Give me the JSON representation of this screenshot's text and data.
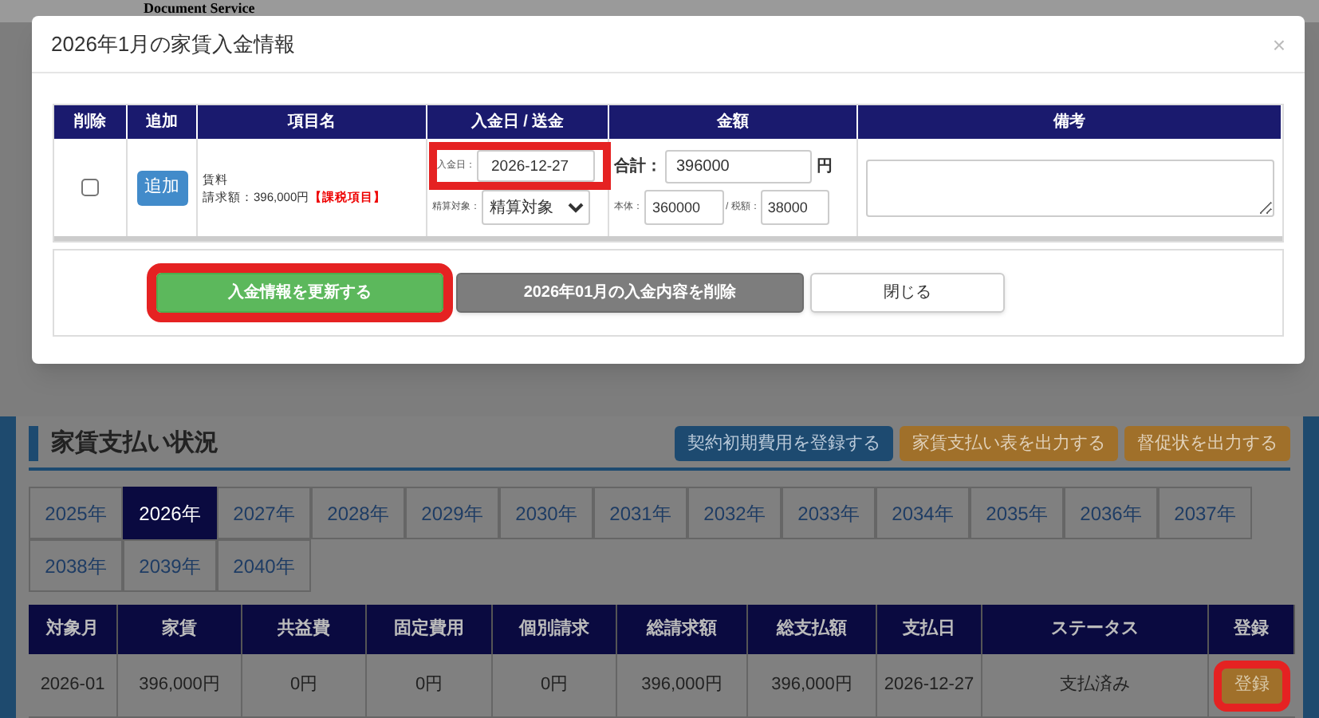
{
  "header": {
    "subtitle": "Document Service"
  },
  "modal": {
    "title": "2026年1月の家賃入金情報",
    "close": "×",
    "columns": [
      "削除",
      "追加",
      "項目名",
      "入金日 / 送金",
      "金額",
      "備考"
    ],
    "row": {
      "delete_checked": false,
      "add_button": "追加",
      "item_name": "賃料",
      "billed": "請求額：396,000円",
      "tax_tag": "【課税項目】",
      "date_label": "入金日：",
      "date_value": "2026-12-27",
      "settle_label": "精算対象：",
      "settle_value": "精算対象",
      "total_label": "合計：",
      "total_value": "396000",
      "yen": "円",
      "base_label": "本体：",
      "base_value": "360000",
      "tax_label": "/ 税額：",
      "tax_value": "38000"
    },
    "buttons": [
      {
        "label": "入金情報を更新する",
        "kind": "primary",
        "highlighted": true
      },
      {
        "label": "2026年01月の入金内容を削除",
        "kind": "danger",
        "highlighted": false
      },
      {
        "label": "閉じる",
        "kind": "default",
        "highlighted": false
      }
    ]
  },
  "section": {
    "title": "家賃支払い状況",
    "actions": [
      {
        "label": "契約初期費用を登録する",
        "kind": "blue"
      },
      {
        "label": "家賃支払い表を出力する",
        "kind": "orange"
      },
      {
        "label": "督促状を出力する",
        "kind": "orange"
      }
    ],
    "years": [
      {
        "label": "2025年",
        "selected": false
      },
      {
        "label": "2026年",
        "selected": true
      },
      {
        "label": "2027年",
        "selected": false
      },
      {
        "label": "2028年",
        "selected": false
      },
      {
        "label": "2029年",
        "selected": false
      },
      {
        "label": "2030年",
        "selected": false
      },
      {
        "label": "2031年",
        "selected": false
      },
      {
        "label": "2032年",
        "selected": false
      },
      {
        "label": "2033年",
        "selected": false
      },
      {
        "label": "2034年",
        "selected": false
      },
      {
        "label": "2035年",
        "selected": false
      },
      {
        "label": "2036年",
        "selected": false
      },
      {
        "label": "2037年",
        "selected": false
      },
      {
        "label": "2038年",
        "selected": false
      },
      {
        "label": "2039年",
        "selected": false
      },
      {
        "label": "2040年",
        "selected": false
      }
    ],
    "table": {
      "columns": [
        "対象月",
        "家賃",
        "共益費",
        "固定費用",
        "個別請求",
        "総請求額",
        "総支払額",
        "支払日",
        "ステータス",
        "登録"
      ],
      "rows": [
        {
          "cells": [
            "2026-01",
            "396,000円",
            "0円",
            "0円",
            "0円",
            "396,000円",
            "396,000円",
            "2026-12-27",
            "支払済み"
          ],
          "button": "登録",
          "highlighted": true
        }
      ]
    }
  }
}
